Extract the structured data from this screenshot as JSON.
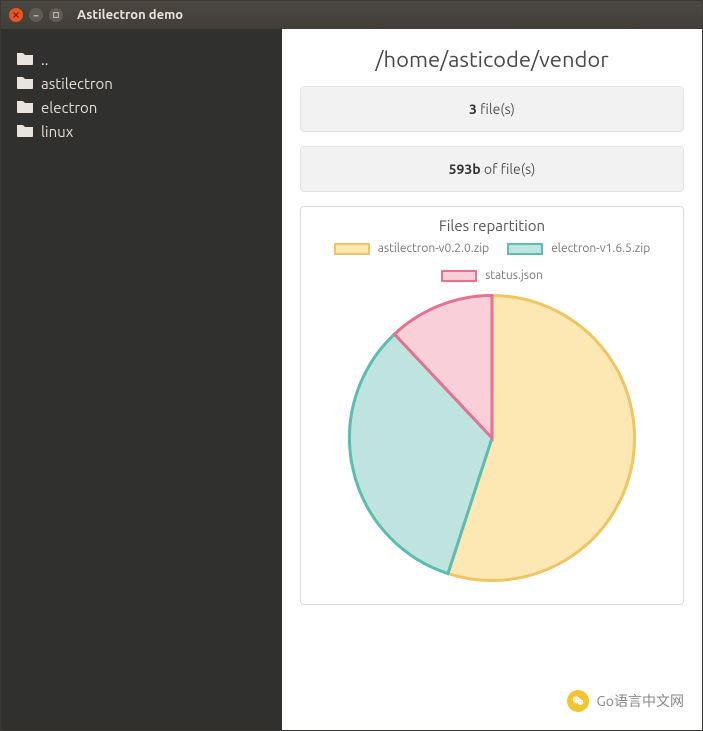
{
  "window": {
    "title": "Astilectron demo"
  },
  "sidebar": {
    "items": [
      {
        "label": ".."
      },
      {
        "label": "astilectron"
      },
      {
        "label": "electron"
      },
      {
        "label": "linux"
      }
    ]
  },
  "main": {
    "path": "/home/asticode/vendor",
    "file_count": "3",
    "file_count_label": " file(s)",
    "total_size": "593b",
    "total_size_label": " of file(s)"
  },
  "chart_data": {
    "type": "pie",
    "title": "Files repartition",
    "series": [
      {
        "name": "astilectron-v0.2.0.zip",
        "value": 55,
        "color_fill": "#fde8b3",
        "color_stroke": "#f1c463"
      },
      {
        "name": "electron-v1.6.5.zip",
        "value": 33,
        "color_fill": "#bfe3de",
        "color_stroke": "#5bbdb2"
      },
      {
        "name": "status.json",
        "value": 12,
        "color_fill": "#f9cfd9",
        "color_stroke": "#e5728f"
      }
    ]
  },
  "footer": {
    "brand": "Go语言中文网"
  }
}
